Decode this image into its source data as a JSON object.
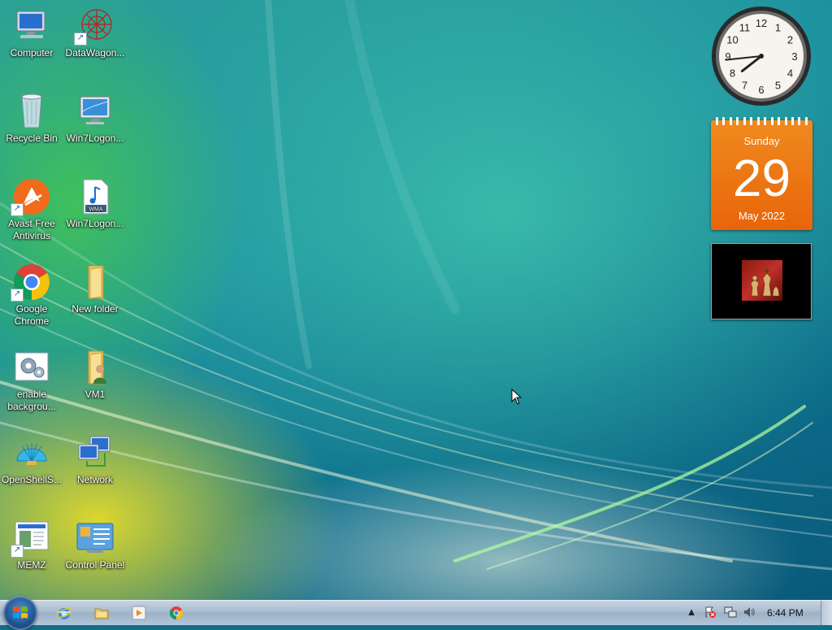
{
  "desktop_icons": [
    {
      "label": "Computer",
      "icon": "computer-icon"
    },
    {
      "label": "DataWagon...",
      "icon": "datawagon-icon",
      "shortcut": true
    },
    {
      "label": "Recycle Bin",
      "icon": "recycle-bin-icon"
    },
    {
      "label": "Win7Logon...",
      "icon": "monitor-icon"
    },
    {
      "label": "Avast Free Antivirus",
      "icon": "avast-icon",
      "shortcut": true
    },
    {
      "label": "Win7Logon...",
      "icon": "wma-file-icon"
    },
    {
      "label": "Google Chrome",
      "icon": "chrome-icon",
      "shortcut": true
    },
    {
      "label": "New folder",
      "icon": "folder-icon"
    },
    {
      "label": "enable backgrou...",
      "icon": "settings-file-icon"
    },
    {
      "label": "VM1",
      "icon": "user-folder-icon"
    },
    {
      "label": "OpenShellS...",
      "icon": "openshell-icon"
    },
    {
      "label": "Network",
      "icon": "network-icon"
    },
    {
      "label": "MEMZ",
      "icon": "memz-icon",
      "shortcut": true
    },
    {
      "label": "Control Panel",
      "icon": "control-panel-icon"
    }
  ],
  "gadgets": {
    "clock": {
      "hour": 7,
      "minute": 44
    },
    "calendar": {
      "weekday": "Sunday",
      "day": "29",
      "month_year": "May 2022"
    },
    "slideshow": {
      "icon": "chess-picture-icon"
    }
  },
  "taskbar": {
    "pinned": [
      "internet-explorer-icon",
      "windows-explorer-icon",
      "media-player-icon",
      "chrome-icon"
    ],
    "tray": [
      "show-hidden-icons-icon",
      "action-center-flag-icon",
      "network-tray-icon",
      "volume-icon"
    ],
    "time": "6:44 PM"
  },
  "colors": {
    "calendar_orange": "#e8650a",
    "taskbar": "#a9bccf"
  }
}
